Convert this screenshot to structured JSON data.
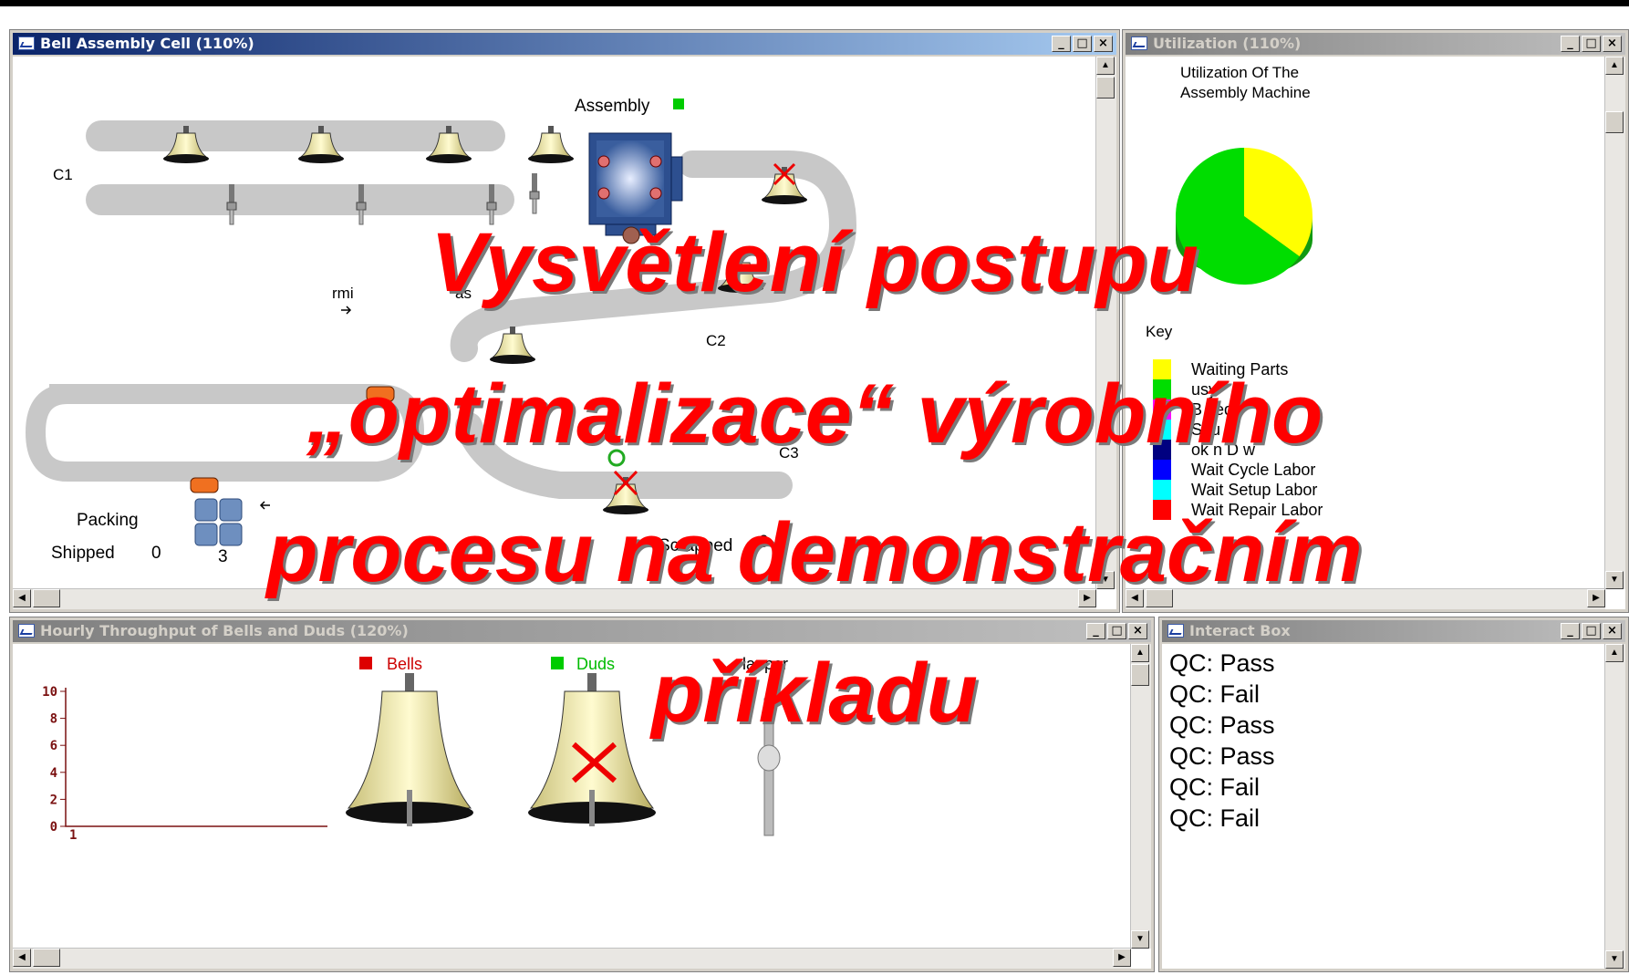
{
  "windows": {
    "bell_cell": {
      "title": "Bell Assembly Cell (110%)",
      "labels": {
        "assembly": "Assembly",
        "c1": "C1",
        "c2": "C2",
        "c3": "C3",
        "packing": "Packing",
        "shipped": "Shipped",
        "shipped_value": "0",
        "packing_count": "3",
        "scrapped": "Scrapped",
        "scrapped_value": "0",
        "frag1": "rmi",
        "frag2": "as"
      },
      "status_colors": {
        "assembly": "#00cc00"
      }
    },
    "utilization": {
      "title": "Utilization (110%)",
      "chart_title_line1": "Utilization Of The",
      "chart_title_line2": "Assembly Machine",
      "key_label": "Key"
    },
    "throughput": {
      "title": "Hourly Throughput of Bells and Duds (120%)",
      "legend_bells": "Bells",
      "legend_duds": "Duds",
      "clapper_label": "lapper"
    },
    "interact": {
      "title": "Interact Box",
      "lines": [
        "QC: Pass",
        "QC: Fail",
        "QC: Pass",
        "QC: Pass",
        "QC: Fail",
        "QC: Fail"
      ]
    }
  },
  "window_buttons": {
    "min": "_",
    "max": "□",
    "close": "×"
  },
  "chart_data": [
    {
      "type": "pie",
      "title": "Utilization Of The Assembly Machine",
      "categories": [
        "Waiting Parts",
        "Busy",
        "Blocked",
        "Setup",
        "Broken Down",
        "Wait Cycle Labor",
        "Wait Setup Labor",
        "Wait Repair Labor"
      ],
      "values": [
        0.35,
        0.65,
        0,
        0,
        0,
        0,
        0,
        0
      ],
      "colors": [
        "#ffff00",
        "#00dd00",
        "#ff00ff",
        "#00ffff",
        "#000080",
        "#0000ff",
        "#00ffff",
        "#ff0000"
      ],
      "legend_labels": [
        "Waiting Parts",
        "Busy",
        "Blocked",
        "Setup",
        "Broken Down",
        "Wait Cycle Labor",
        "Wait Setup Labor",
        "Wait Repair Labor"
      ],
      "legend_visible": [
        "Waiting Parts",
        "usy",
        "B  ked",
        "S  tu",
        "ok n D  w",
        "Wait Cycle Labor",
        "Wait Setup Labor",
        "Wait Repair Labor"
      ]
    },
    {
      "type": "line",
      "title": "",
      "series": [
        {
          "name": "Bells",
          "values": []
        },
        {
          "name": "Duds",
          "values": []
        }
      ],
      "y_ticks": [
        "10",
        "8",
        "6",
        "4",
        "2",
        "0"
      ],
      "x_ticks": [
        "1"
      ],
      "ylim": [
        0,
        10
      ],
      "xlim": [
        1,
        2
      ]
    }
  ],
  "overlay": {
    "line1": "Vysvětlení postupu",
    "line2": "„optimalizace“ výrobního",
    "line3": "procesu na demonstračním",
    "line4": "příkladu"
  }
}
